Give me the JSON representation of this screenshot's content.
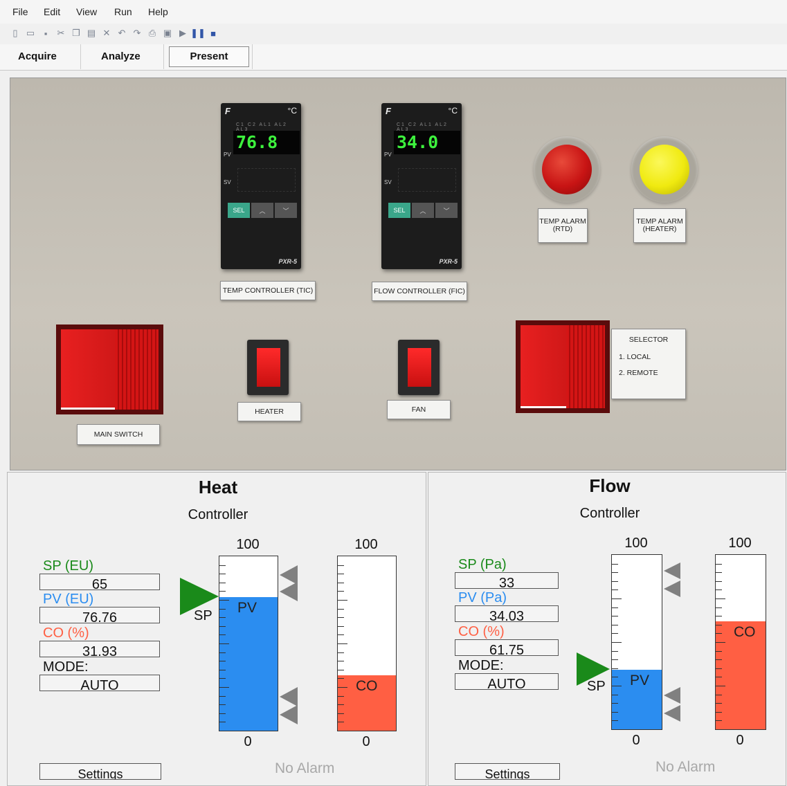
{
  "menu": [
    "File",
    "Edit",
    "View",
    "Run",
    "Help"
  ],
  "toolbar_icons": [
    "new-icon",
    "open-icon",
    "save-icon",
    "cut-icon",
    "copy-icon",
    "paste-icon",
    "delete-icon",
    "undo-icon",
    "redo-icon",
    "print-icon",
    "image-icon",
    "run-icon",
    "pause-icon",
    "stop-icon"
  ],
  "tabs": [
    "Acquire",
    "Analyze",
    "Present"
  ],
  "selected_tab": "Present",
  "photo": {
    "tic": {
      "brand": "F",
      "deg": "°C",
      "leds": "C1 C2 AL1 AL2 AL3",
      "pv_label": "PV",
      "sv_label": "SV",
      "pv": "76.8",
      "sel": "SEL",
      "model": "PXR-5",
      "plate": "TEMP CONTROLLER (TIC)"
    },
    "fic": {
      "brand": "F",
      "deg": "°C",
      "leds": "C1 C2 AL1 AL2 AL3",
      "pv_label": "PV",
      "sv_label": "SV",
      "pv": "34.0",
      "sel": "SEL",
      "model": "PXR-5",
      "plate": "FLOW CONTROLLER (FIC)"
    },
    "alarm_rtd": "TEMP ALARM (RTD)",
    "alarm_heater": "TEMP ALARM (HEATER)",
    "main_switch": "MAIN SWITCH",
    "heater": "HEATER",
    "fan": "FAN",
    "selector_title": "SELECTOR",
    "selector_opt1": "1. LOCAL",
    "selector_opt2": "2. REMOTE",
    "colors": {
      "red_lamp": "#c81414",
      "yellow_lamp": "#f0ea10"
    }
  },
  "heat": {
    "title": "Heat",
    "subtitle": "Controller",
    "sp_label": "SP (EU)",
    "sp": "65",
    "pv_label": "PV (EU)",
    "pv": "76.76",
    "co_label": "CO (%)",
    "co": "31.93",
    "mode_label": "MODE:",
    "mode": "AUTO",
    "scale_max": "100",
    "scale_min": "0",
    "pv_fill_pct": 76.76,
    "co_fill_pct": 31.93,
    "sp_pct": 65,
    "pv_tag": "PV",
    "co_tag": "CO",
    "sp_tag": "SP",
    "alarm": "No Alarm",
    "settings": "Settings"
  },
  "flow": {
    "title": "Flow",
    "subtitle": "Controller",
    "sp_label": "SP (Pa)",
    "sp": "33",
    "pv_label": "PV (Pa)",
    "pv": "34.03",
    "co_label": "CO (%)",
    "co": "61.75",
    "mode_label": "MODE:",
    "mode": "AUTO",
    "scale_max": "100",
    "scale_min": "0",
    "pv_fill_pct": 34.03,
    "co_fill_pct": 61.75,
    "sp_pct": 33,
    "pv_tag": "PV",
    "co_tag": "CO",
    "sp_tag": "SP",
    "alarm": "No Alarm",
    "settings": "Settings"
  },
  "colors": {
    "sp": "#1a8a1a",
    "pv": "#2b8df0",
    "co": "#ff5f43",
    "alarm_text": "#a8a8a8"
  }
}
